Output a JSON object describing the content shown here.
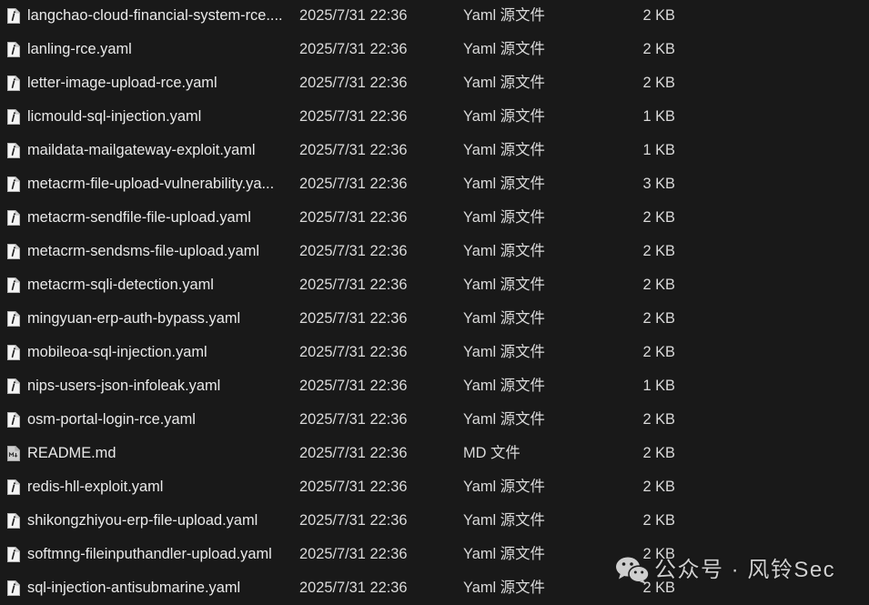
{
  "theme": {
    "background": "#191919",
    "text_primary": "#eaeaea",
    "text_secondary": "#dadada",
    "watermark": "#cfcfcf"
  },
  "files": [
    {
      "icon": "yaml-file-icon",
      "name": "langchao-cloud-financial-system-rce....",
      "modified": "2025/7/31 22:36",
      "type": "Yaml 源文件",
      "size": "2 KB"
    },
    {
      "icon": "yaml-file-icon",
      "name": "lanling-rce.yaml",
      "modified": "2025/7/31 22:36",
      "type": "Yaml 源文件",
      "size": "2 KB"
    },
    {
      "icon": "yaml-file-icon",
      "name": "letter-image-upload-rce.yaml",
      "modified": "2025/7/31 22:36",
      "type": "Yaml 源文件",
      "size": "2 KB"
    },
    {
      "icon": "yaml-file-icon",
      "name": "licmould-sql-injection.yaml",
      "modified": "2025/7/31 22:36",
      "type": "Yaml 源文件",
      "size": "1 KB"
    },
    {
      "icon": "yaml-file-icon",
      "name": "maildata-mailgateway-exploit.yaml",
      "modified": "2025/7/31 22:36",
      "type": "Yaml 源文件",
      "size": "1 KB"
    },
    {
      "icon": "yaml-file-icon",
      "name": "metacrm-file-upload-vulnerability.ya...",
      "modified": "2025/7/31 22:36",
      "type": "Yaml 源文件",
      "size": "3 KB"
    },
    {
      "icon": "yaml-file-icon",
      "name": "metacrm-sendfile-file-upload.yaml",
      "modified": "2025/7/31 22:36",
      "type": "Yaml 源文件",
      "size": "2 KB"
    },
    {
      "icon": "yaml-file-icon",
      "name": "metacrm-sendsms-file-upload.yaml",
      "modified": "2025/7/31 22:36",
      "type": "Yaml 源文件",
      "size": "2 KB"
    },
    {
      "icon": "yaml-file-icon",
      "name": "metacrm-sqli-detection.yaml",
      "modified": "2025/7/31 22:36",
      "type": "Yaml 源文件",
      "size": "2 KB"
    },
    {
      "icon": "yaml-file-icon",
      "name": "mingyuan-erp-auth-bypass.yaml",
      "modified": "2025/7/31 22:36",
      "type": "Yaml 源文件",
      "size": "2 KB"
    },
    {
      "icon": "yaml-file-icon",
      "name": "mobileoa-sql-injection.yaml",
      "modified": "2025/7/31 22:36",
      "type": "Yaml 源文件",
      "size": "2 KB"
    },
    {
      "icon": "yaml-file-icon",
      "name": "nips-users-json-infoleak.yaml",
      "modified": "2025/7/31 22:36",
      "type": "Yaml 源文件",
      "size": "1 KB"
    },
    {
      "icon": "yaml-file-icon",
      "name": "osm-portal-login-rce.yaml",
      "modified": "2025/7/31 22:36",
      "type": "Yaml 源文件",
      "size": "2 KB"
    },
    {
      "icon": "markdown-file-icon",
      "name": "README.md",
      "modified": "2025/7/31 22:36",
      "type": "MD 文件",
      "size": "2 KB"
    },
    {
      "icon": "yaml-file-icon",
      "name": "redis-hll-exploit.yaml",
      "modified": "2025/7/31 22:36",
      "type": "Yaml 源文件",
      "size": "2 KB"
    },
    {
      "icon": "yaml-file-icon",
      "name": "shikongzhiyou-erp-file-upload.yaml",
      "modified": "2025/7/31 22:36",
      "type": "Yaml 源文件",
      "size": "2 KB"
    },
    {
      "icon": "yaml-file-icon",
      "name": "softmng-fileinputhandler-upload.yaml",
      "modified": "2025/7/31 22:36",
      "type": "Yaml 源文件",
      "size": "2 KB"
    },
    {
      "icon": "yaml-file-icon",
      "name": "sql-injection-antisubmarine.yaml",
      "modified": "2025/7/31 22:36",
      "type": "Yaml 源文件",
      "size": "2 KB"
    }
  ],
  "watermark": {
    "icon": "wechat-icon",
    "text": "公众号 · 风铃Sec"
  }
}
